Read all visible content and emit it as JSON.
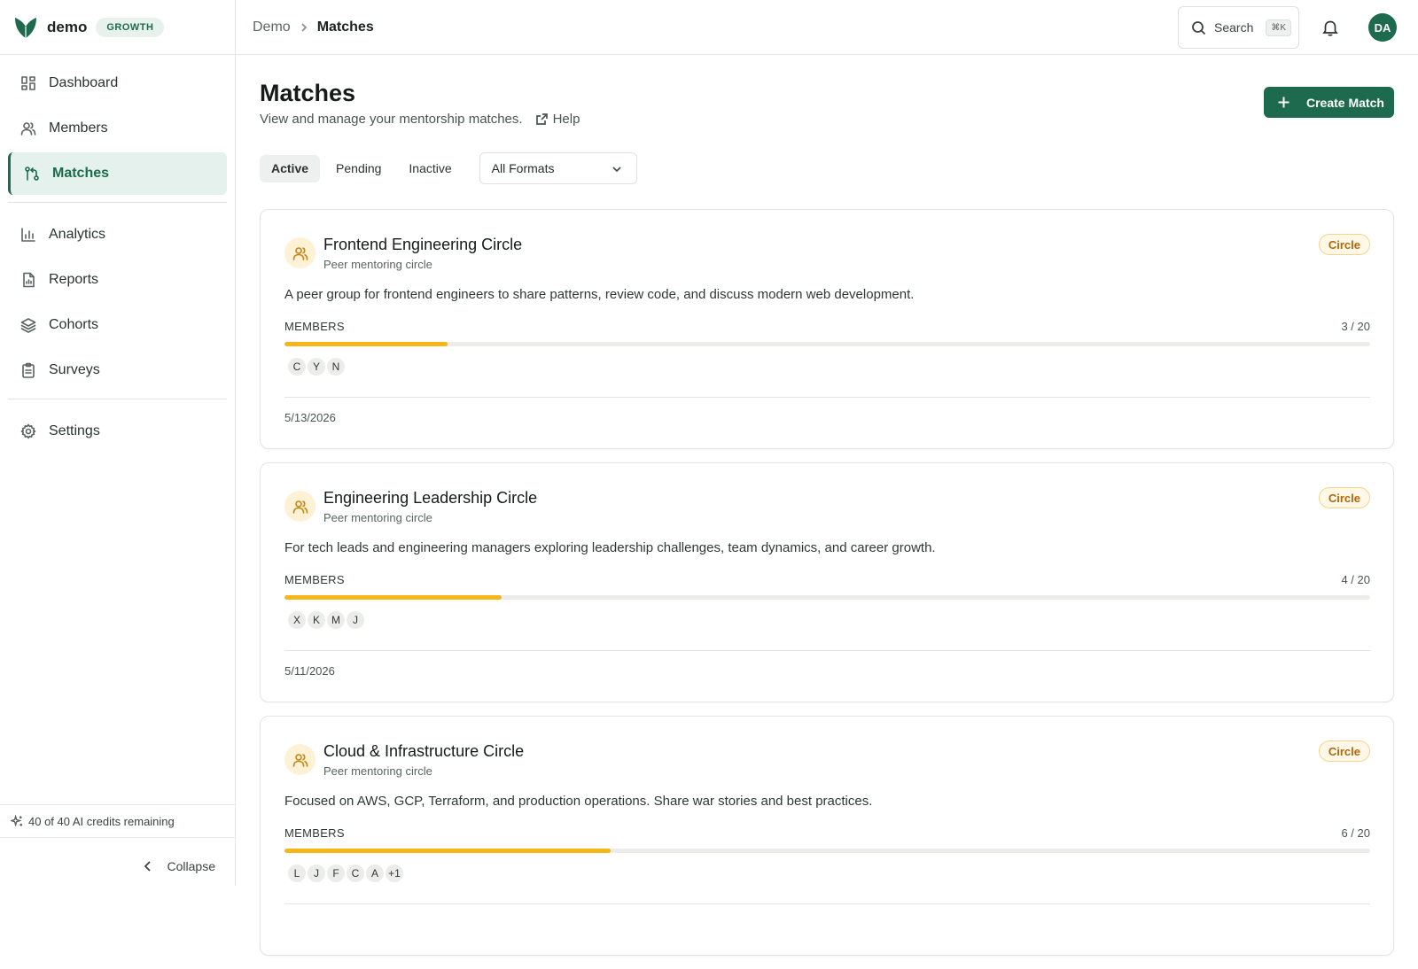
{
  "brand": {
    "name": "demo",
    "plan": "GROWTH"
  },
  "sidebar": {
    "items": [
      {
        "label": "Dashboard",
        "icon": "dashboard-icon"
      },
      {
        "label": "Members",
        "icon": "users-icon"
      },
      {
        "label": "Matches",
        "icon": "git-pull-icon",
        "active": true
      },
      {
        "label": "Analytics",
        "icon": "bar-chart-icon"
      },
      {
        "label": "Reports",
        "icon": "file-chart-icon"
      },
      {
        "label": "Cohorts",
        "icon": "layers-icon"
      },
      {
        "label": "Surveys",
        "icon": "clipboard-icon"
      },
      {
        "label": "Settings",
        "icon": "gear-icon"
      }
    ],
    "credits": "40 of 40 AI credits remaining",
    "collapse": "Collapse"
  },
  "topbar": {
    "breadcrumb_root": "Demo",
    "breadcrumb_current": "Matches",
    "search_label": "Search",
    "search_shortcut": "⌘K",
    "user_initials": "DA"
  },
  "page": {
    "title": "Matches",
    "subtitle": "View and manage your mentorship matches.",
    "help": "Help",
    "create_button": "Create Match",
    "tabs": [
      {
        "label": "Active",
        "active": true
      },
      {
        "label": "Pending"
      },
      {
        "label": "Inactive"
      }
    ],
    "format_filter": "All Formats"
  },
  "colors": {
    "brand": "#1d6a4e",
    "progress": "#f6b519",
    "badge_text": "#b4650a"
  },
  "matches": [
    {
      "title": "Frontend Engineering Circle",
      "subtitle": "Peer mentoring circle",
      "type": "Circle",
      "description": "A peer group for frontend engineers to share patterns, review code, and discuss modern web development.",
      "members_label": "MEMBERS",
      "members_count": "3 / 20",
      "progress": 0.15,
      "avatars": [
        "C",
        "Y",
        "N"
      ],
      "date": "5/13/2026"
    },
    {
      "title": "Engineering Leadership Circle",
      "subtitle": "Peer mentoring circle",
      "type": "Circle",
      "description": "For tech leads and engineering managers exploring leadership challenges, team dynamics, and career growth.",
      "members_label": "MEMBERS",
      "members_count": "4 / 20",
      "progress": 0.2,
      "avatars": [
        "X",
        "K",
        "M",
        "J"
      ],
      "date": "5/11/2026"
    },
    {
      "title": "Cloud & Infrastructure Circle",
      "subtitle": "Peer mentoring circle",
      "type": "Circle",
      "description": "Focused on AWS, GCP, Terraform, and production operations. Share war stories and best practices.",
      "members_label": "MEMBERS",
      "members_count": "6 / 20",
      "progress": 0.3,
      "avatars": [
        "L",
        "J",
        "F",
        "C",
        "A",
        "+1"
      ],
      "date": ""
    }
  ]
}
